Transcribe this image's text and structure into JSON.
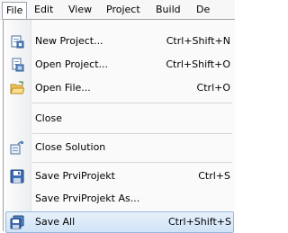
{
  "menubar": {
    "items": [
      {
        "label": "File"
      },
      {
        "label": "Edit"
      },
      {
        "label": "View"
      },
      {
        "label": "Project"
      },
      {
        "label": "Build"
      },
      {
        "label": "De"
      }
    ]
  },
  "file_menu": {
    "items": [
      {
        "label": "New Project...",
        "shortcut": "Ctrl+Shift+N",
        "icon": "new-project-icon"
      },
      {
        "label": "Open Project...",
        "shortcut": "Ctrl+Shift+O",
        "icon": "open-project-icon"
      },
      {
        "label": "Open File...",
        "shortcut": "Ctrl+O",
        "icon": "open-folder-icon"
      },
      {
        "label": "Close",
        "shortcut": ""
      },
      {
        "label": "Close Solution",
        "shortcut": "",
        "icon": "close-solution-icon"
      },
      {
        "label": "Save PrviProjekt",
        "shortcut": "Ctrl+S",
        "icon": "save-icon"
      },
      {
        "label": "Save PrviProjekt As...",
        "shortcut": ""
      },
      {
        "label": "Save All",
        "shortcut": "Ctrl+Shift+S",
        "icon": "save-all-icon",
        "highlighted": true
      }
    ]
  },
  "colors": {
    "highlight_bg": "#cfe3f7",
    "highlight_border": "#98b8dd",
    "menu_bg": "#fafafa"
  }
}
